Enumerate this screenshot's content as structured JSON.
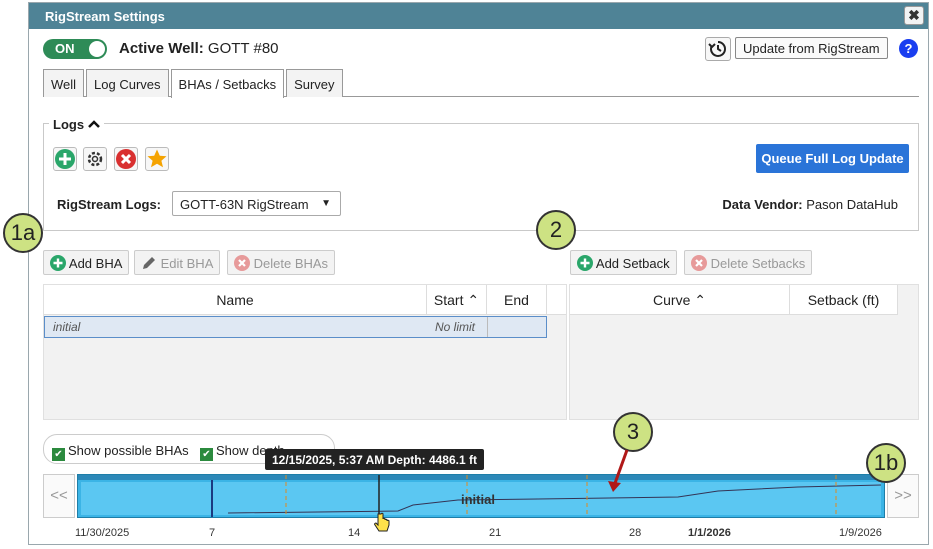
{
  "window": {
    "title": "RigStream Settings",
    "close_label": "✖"
  },
  "header": {
    "toggle_label": "ON",
    "active_well_label": "Active Well:",
    "active_well_value": "GOTT #80",
    "update_button": "Update from RigStream",
    "help_label": "?"
  },
  "tabs": [
    {
      "label": "Well"
    },
    {
      "label": "Log Curves"
    },
    {
      "label": "BHAs / Setbacks"
    },
    {
      "label": "Survey"
    }
  ],
  "logs": {
    "legend": "Logs",
    "queue_button": "Queue Full Log Update",
    "rigstream_logs_label": "RigStream Logs:",
    "rigstream_logs_value": "GOTT-63N RigStream",
    "vendor_label": "Data Vendor:",
    "vendor_value": "Pason DataHub"
  },
  "callouts": {
    "c1a": "1a",
    "c2": "2",
    "c3": "3",
    "c1b": "1b"
  },
  "bha": {
    "add_label": "Add BHA",
    "edit_label": "Edit BHA",
    "delete_label": "Delete BHAs",
    "columns": [
      "Name",
      "Start ⌃",
      "End"
    ],
    "rows": [
      {
        "name": "initial",
        "start": "No limit",
        "end": ""
      }
    ]
  },
  "setbacks": {
    "add_label": "Add Setback",
    "delete_label": "Delete Setbacks",
    "columns": [
      "Curve ⌃",
      "Setback (ft)"
    ]
  },
  "options": {
    "show_bhas": "Show possible BHAs",
    "show_depth": "Show depth"
  },
  "timeline": {
    "prev": "<<",
    "next": ">>",
    "bar_label": "initial",
    "tooltip": "12/15/2025, 5:37 AM Depth: 4486.1 ft",
    "dates": [
      "11/30/2025",
      "7",
      "14",
      "21",
      "28",
      "1/1/2026",
      "1/9/2026"
    ]
  },
  "colors": {
    "titlebar": "#4f8396",
    "toggle": "#2e8b57",
    "primary": "#2a74d8",
    "timeline": "#3bb4e6",
    "callout": "#cde283"
  }
}
